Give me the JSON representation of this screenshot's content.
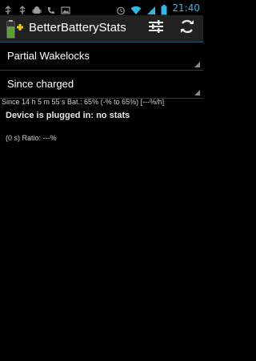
{
  "status_bar": {
    "time": "21:40",
    "left_icons": [
      "usb-icon",
      "usb-icon",
      "android-debug-icon",
      "missed-call-icon",
      "image-icon"
    ],
    "right_icons": [
      "alarm-icon",
      "wifi-icon",
      "signal-icon",
      "battery-icon"
    ]
  },
  "action_bar": {
    "title": "BetterBatteryStats",
    "actions": [
      "filters-icon",
      "refresh-icon"
    ]
  },
  "spinners": {
    "stat_type": "Partial Wakelocks",
    "reference": "Since charged"
  },
  "info": {
    "since_line": "Since 14 h 5 m 55 s  Bat.: 65% (-% to 65%) [---%/h]",
    "plugged_message": "Device is plugged in: no stats",
    "ratio_line": "(0 s) Ratio: ---%"
  },
  "colors": {
    "accent": "#33b5e5",
    "action_bar_bg": "#212121",
    "background": "#000000"
  }
}
